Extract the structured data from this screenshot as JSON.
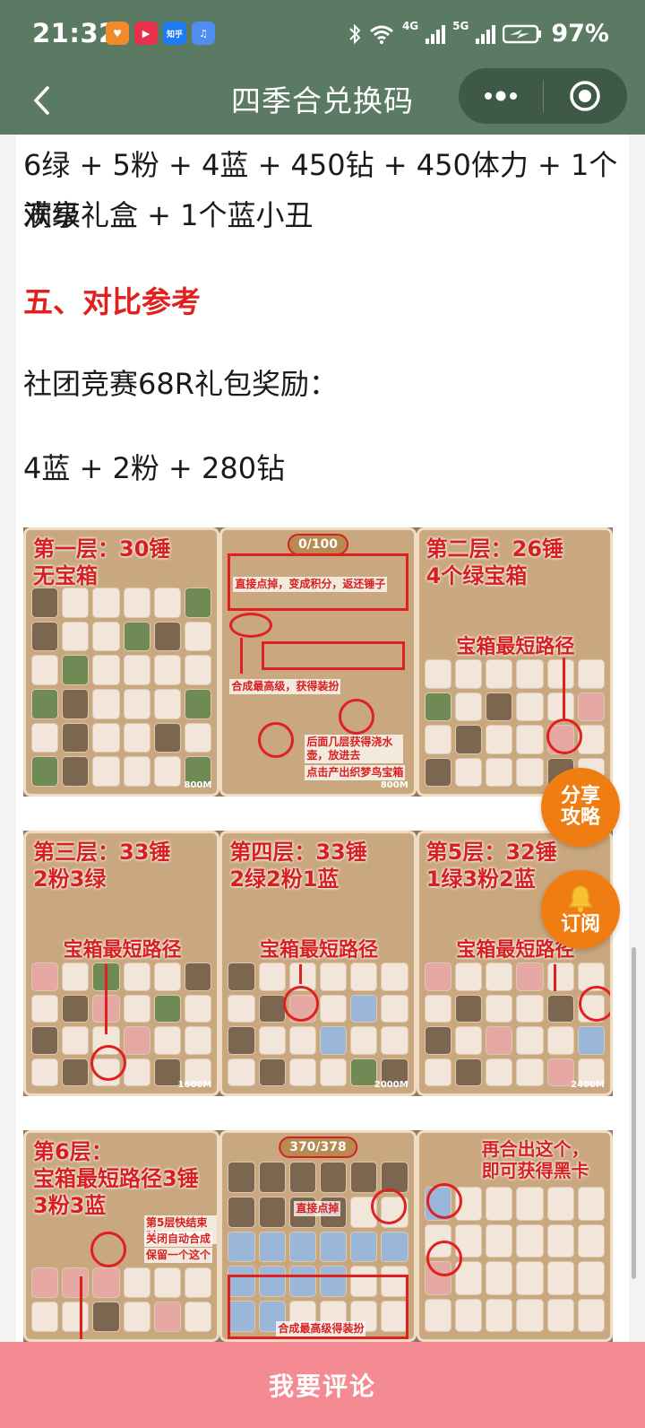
{
  "status_bar": {
    "time": "21:32",
    "app_icons": [
      {
        "name": "heart-app-icon",
        "color": "#f08a2b",
        "glyph": "♥"
      },
      {
        "name": "play-app-icon",
        "color": "#e8304a",
        "glyph": "▶"
      },
      {
        "name": "zhihu-app-icon",
        "color": "#1a7bf2",
        "glyph": "知乎"
      },
      {
        "name": "music-app-icon",
        "color": "#4f8df0",
        "glyph": "♫"
      }
    ],
    "network_4g": "4G",
    "network_5g": "5G",
    "battery": "97%"
  },
  "nav": {
    "title": "四季合兑换码"
  },
  "article": {
    "reward_line_1": "6绿 + 5粉 + 4蓝 + 450钻 + 450体力 + 1个满级",
    "reward_line_2": "欢享礼盒 + 1个蓝小丑",
    "section_heading": "五、对比参考",
    "club_title": "社团竞赛68R礼包奖励：",
    "club_reward": "4蓝 + 2粉 + 280钻",
    "strip1": {
      "panel1": {
        "caption_1": "第一层：30锤",
        "caption_2": "无宝箱",
        "level": "800M"
      },
      "panel2": {
        "counter": "0/100",
        "note_1": "直接点掉，变成积分，返还锤子",
        "note_2": "合成最高级，获得装扮",
        "note_3": "后面几层获得浇水壶，放进去",
        "note_4": "点击产出织梦鸟宝箱",
        "level": "800M"
      },
      "panel3": {
        "caption_1": "第二层：26锤",
        "caption_2": "4个绿宝箱",
        "sub": "宝箱最短路径"
      }
    },
    "strip2": {
      "panel1": {
        "caption_1": "第三层：33锤",
        "caption_2": "2粉3绿",
        "sub": "宝箱最短路径",
        "level": "1600M"
      },
      "panel2": {
        "caption_1": "第四层：33锤",
        "caption_2": "2绿2粉1蓝",
        "sub": "宝箱最短路径",
        "level": "2000M"
      },
      "panel3": {
        "caption_1": "第5层：32锤",
        "caption_2": "1绿3粉2蓝",
        "sub": "宝箱最短路径",
        "level": "2400M"
      }
    },
    "strip3": {
      "panel1": {
        "caption_1": "第6层：",
        "caption_2": "宝箱最短路径3锤",
        "caption_3": "3粉3蓝",
        "note_1": "第5层快结束时",
        "note_2": "关闭自动合成",
        "note_3": "保留一个这个"
      },
      "panel2": {
        "counter": "370/378",
        "note_1": "直接点掉",
        "note_2": "合成最高级得装扮"
      },
      "panel3": {
        "caption_1": "再合出这个，",
        "caption_2": "即可获得黑卡"
      }
    }
  },
  "fab_share": {
    "line_1": "分享",
    "line_2": "攻略"
  },
  "fab_subscribe": {
    "line_1": "订阅"
  },
  "comment_bar": {
    "label": "我要评论"
  }
}
